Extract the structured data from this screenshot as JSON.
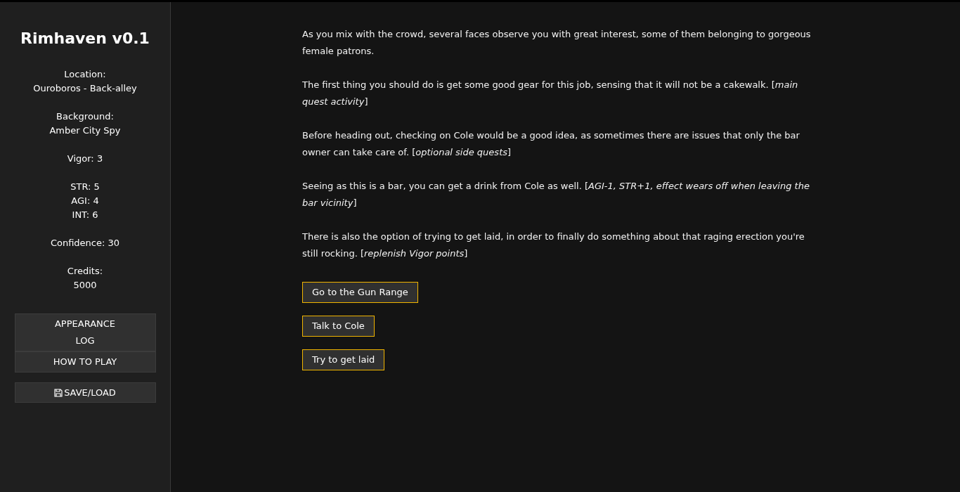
{
  "sidebar": {
    "title": "Rimhaven v0.1",
    "stats": [
      [
        "Location:",
        "Ouroboros - Back-alley"
      ],
      [
        "Background:",
        "Amber City Spy"
      ],
      [
        "Vigor: 3"
      ],
      [
        "STR: 5",
        "AGI: 4",
        "INT: 6"
      ],
      [
        "Confidence: 30"
      ],
      [
        "Credits:",
        "5000"
      ]
    ],
    "menu_groups": [
      [
        "APPEARANCE",
        "LOG"
      ],
      [
        "HOW TO PLAY"
      ]
    ],
    "save_button": "SAVE/LOAD"
  },
  "story": {
    "paragraphs": [
      "As you mix with the crowd, several faces observe you with great interest, some of them belonging to gorgeous female patrons.",
      "The first thing you should do is get some good gear for this job, sensing that it will not be a cakewalk. [*main quest activity*]",
      "Before heading out, checking on Cole would be a good idea, as sometimes there are issues that only the bar owner can take care of. [*optional side quests*]",
      "Seeing as this is a bar, you can get a drink from Cole as well. [*AGI-1, STR+1, effect wears off when leaving the bar vicinity*]",
      "There is also the option of trying to get laid, in order to finally do something about that raging erection you're still rocking. [*replenish Vigor points*]"
    ],
    "choices": [
      "Go to the Gun Range",
      "Talk to Cole",
      "Try to get laid"
    ]
  }
}
